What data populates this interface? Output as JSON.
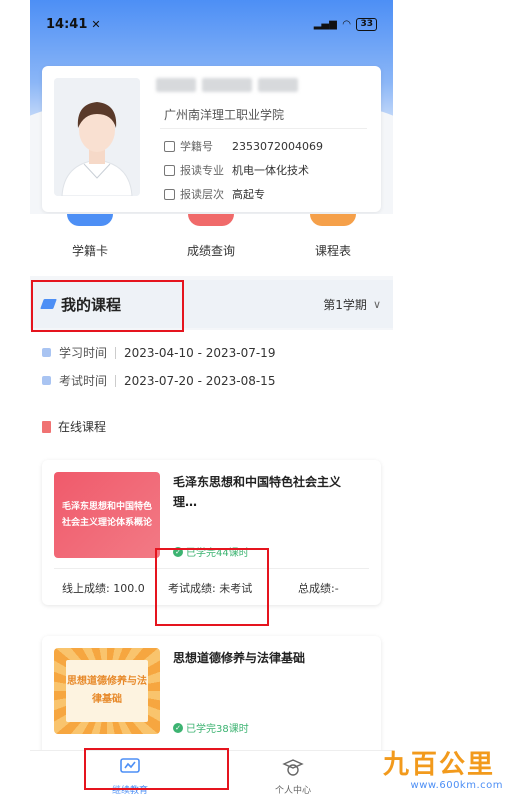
{
  "status_bar": {
    "time": "14:41",
    "signal": "5G",
    "battery": "33"
  },
  "profile": {
    "school": "广州南洋理工职业学院",
    "rows": [
      {
        "label": "学籍号",
        "value": "2353072004069"
      },
      {
        "label": "报读专业",
        "value": "机电一体化技术"
      },
      {
        "label": "报读层次",
        "value": "高起专"
      }
    ]
  },
  "quick_actions": [
    {
      "label": "学籍卡",
      "color": "#4d8ff5"
    },
    {
      "label": "成绩查询",
      "color": "#f06a6a"
    },
    {
      "label": "课程表",
      "color": "#f5a04a"
    }
  ],
  "courses_section": {
    "title": "我的课程",
    "semester": "第1学期",
    "study_time_label": "学习时间",
    "study_time": "2023-04-10 - 2023-07-19",
    "exam_time_label": "考试时间",
    "exam_time": "2023-07-20 - 2023-08-15",
    "online_title": "在线课程"
  },
  "courses": [
    {
      "cover_text": "毛泽东思想和中国特色社会主义理论体系概论",
      "title": "毛泽东思想和中国特色社会主义理…",
      "progress": "已学完44课时",
      "online_score": "线上成绩: 100.0",
      "exam_score": "考试成绩: 未考试",
      "total_score": "总成绩:-"
    },
    {
      "cover_text": "思想道德修养与法律基础",
      "title": "思想道德修养与法律基础",
      "progress": "已学完38课时"
    }
  ],
  "tabbar": [
    {
      "label": "继续教育",
      "active": true
    },
    {
      "label": "个人中心",
      "active": false
    }
  ],
  "watermark": {
    "text": "九百公里",
    "url": "www.600km.com"
  },
  "colors": {
    "accent": "#4d8ff5",
    "annotation": "#e5141e",
    "success": "#3cb371"
  }
}
